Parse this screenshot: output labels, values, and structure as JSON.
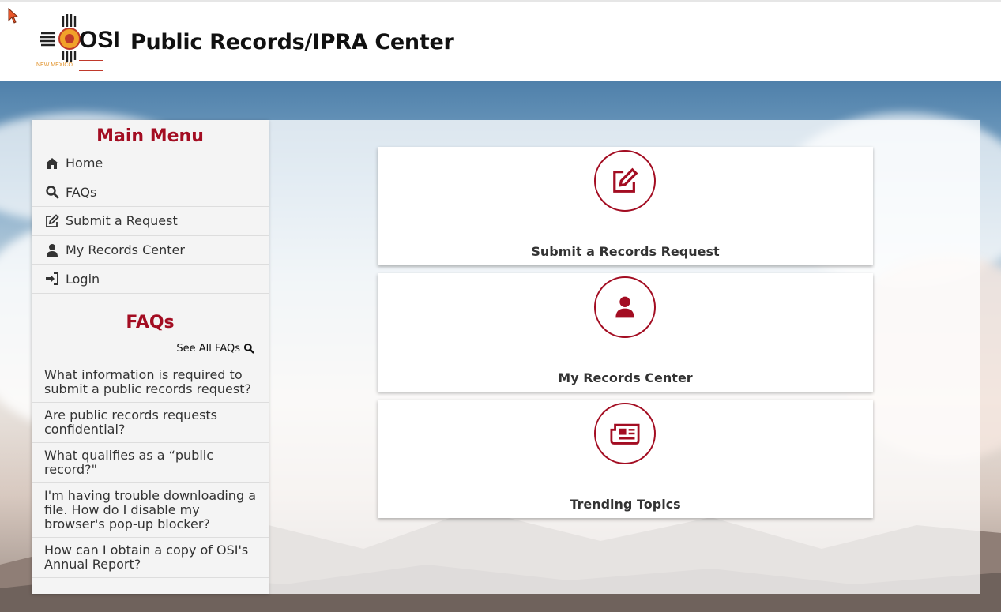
{
  "header": {
    "title": "Public Records/IPRA Center",
    "logo_text": "OSI",
    "logo_subtext": "NEW MEXICO"
  },
  "colors": {
    "accent": "#a30d22",
    "text": "#333333"
  },
  "sidebar": {
    "menu_title": "Main Menu",
    "menu_items": [
      {
        "label": "Home",
        "icon": "home-icon"
      },
      {
        "label": "FAQs",
        "icon": "search-icon"
      },
      {
        "label": "Submit a Request",
        "icon": "edit-icon"
      },
      {
        "label": "My Records Center",
        "icon": "user-icon"
      },
      {
        "label": "Login",
        "icon": "sign-in-icon"
      }
    ],
    "faq_title": "FAQs",
    "see_all_label": "See All FAQs",
    "faqs": [
      "What information is required to submit a public records request?",
      "Are public records requests confidential?",
      "What qualifies as a “public record?\"",
      "I'm having trouble downloading a file. How do I disable my browser's pop-up blocker?",
      "How can I obtain a copy of OSI's Annual Report?"
    ]
  },
  "cards": [
    {
      "label": "Submit a Records Request",
      "icon": "edit-icon"
    },
    {
      "label": "My Records Center",
      "icon": "user-icon"
    },
    {
      "label": "Trending Topics",
      "icon": "newspaper-icon"
    }
  ]
}
